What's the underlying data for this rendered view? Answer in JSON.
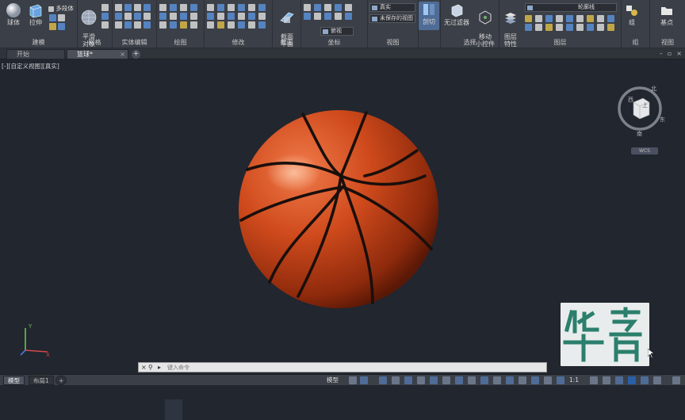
{
  "ribbon": {
    "groups": [
      {
        "label": "建模",
        "buttons": [
          "球体",
          "拉伸"
        ],
        "extra": "多段体"
      },
      {
        "label": "网格",
        "buttons": [
          "平滑\n对象"
        ]
      },
      {
        "label": "实体编辑"
      },
      {
        "label": "绘图"
      },
      {
        "label": "修改"
      },
      {
        "label": "截面",
        "buttons": [
          "截面\n平面"
        ]
      },
      {
        "label": "坐标"
      },
      {
        "label": "视图",
        "dropdowns": [
          "真实",
          "未保存的视图",
          "俯视"
        ]
      },
      {
        "label": "",
        "buttons": [
          "剖切"
        ]
      },
      {
        "label": "选择",
        "buttons": [
          "无过滤器",
          "移动\n小控件"
        ]
      },
      {
        "label": "图层",
        "buttons": [
          "图层\n特性"
        ],
        "dropdowns": [
          "轮廓线"
        ]
      },
      {
        "label": "组",
        "buttons": [
          "组"
        ]
      },
      {
        "label": "视图",
        "buttons": [
          "基点"
        ]
      }
    ]
  },
  "tabs": {
    "start": "开始",
    "drawing": "篮球*",
    "add": "+"
  },
  "viewport": {
    "label": "[-][自定义视图][真实]",
    "controls": [
      "–",
      "▫",
      "×"
    ],
    "viewcube": {
      "north": "北",
      "south": "南",
      "east": "东",
      "west": "西",
      "top": "上",
      "wcs": "WCS"
    },
    "ucs_axes": {
      "x": "X",
      "y": "Y",
      "z": "Z"
    }
  },
  "command_line": {
    "placeholder": "键入命令"
  },
  "layout_tabs": [
    "模型",
    "布局1",
    "+"
  ],
  "status": {
    "model": "模型",
    "scale": "1:1"
  },
  "colors": {
    "viewport_bg": "#21262f",
    "ball": "#c7461c",
    "watermark_green": "#2b7f6c"
  }
}
